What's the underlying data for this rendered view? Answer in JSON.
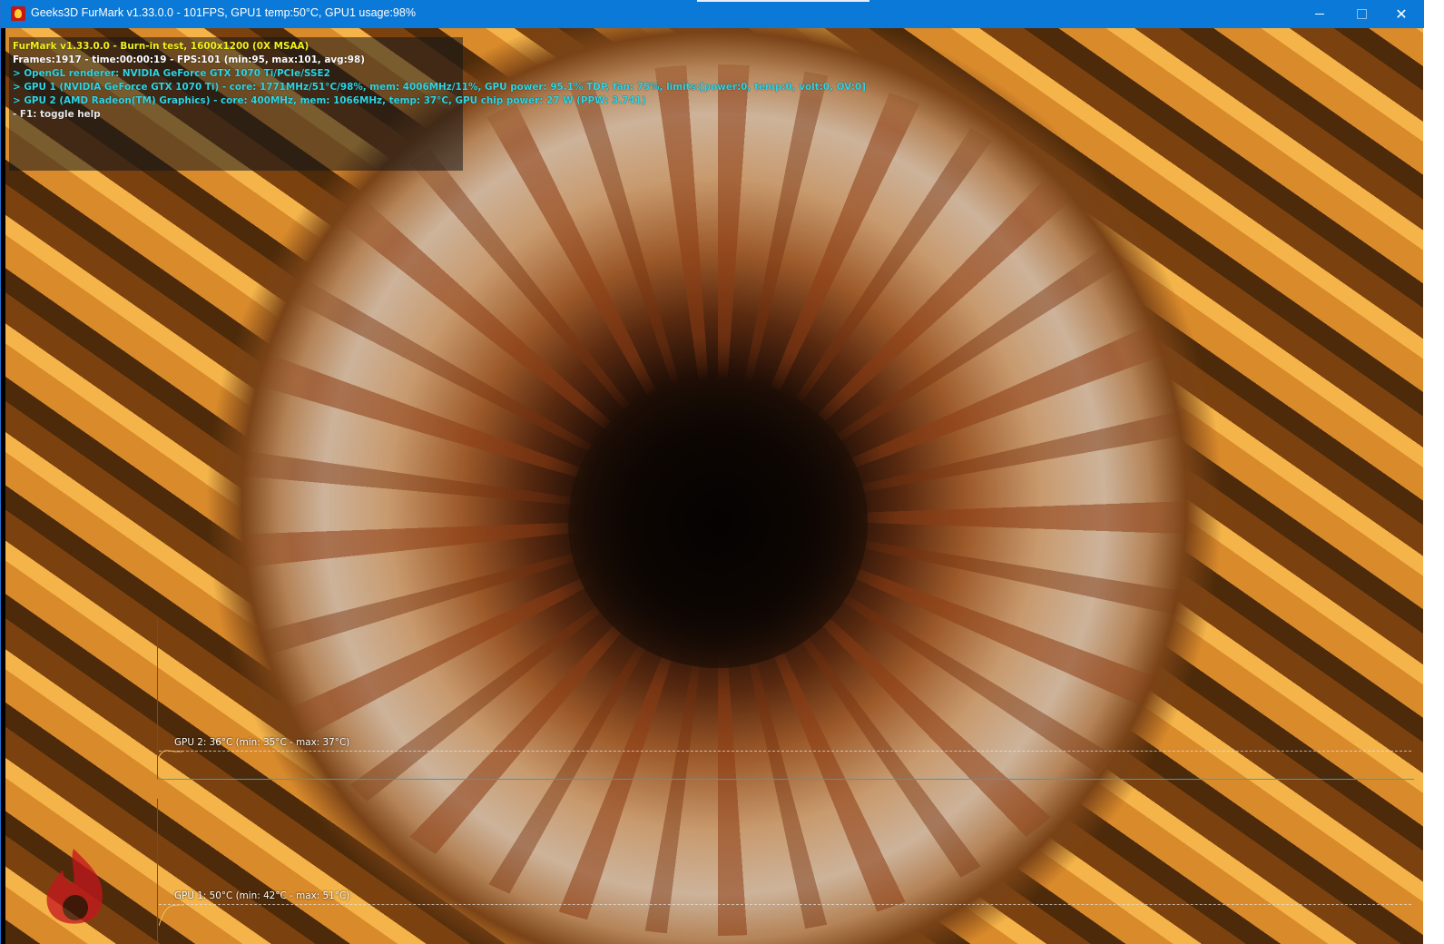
{
  "window": {
    "title": "Geeks3D FurMark v1.33.0.0 - 101FPS, GPU1 temp:50°C, GPU1 usage:98%",
    "controls": {
      "minimize": "minimize",
      "maximize": "maximize",
      "close": "✕"
    }
  },
  "hud": {
    "line1": "FurMark v1.33.0.0 - Burn-in test, 1600x1200 (0X MSAA)",
    "line2": "Frames:1917 - time:00:00:19 - FPS:101 (min:95, max:101, avg:98)",
    "line3": "> OpenGL renderer: NVIDIA GeForce GTX 1070 Ti/PCIe/SSE2",
    "line4": "> GPU 1 (NVIDIA GeForce GTX 1070 Ti) - core: 1771MHz/51°C/98%, mem: 4006MHz/11%, GPU power: 95.1% TDP, fan: 75%, limits:[power:0, temp:0, volt:0, OV:0]",
    "line5": "> GPU 2 (AMD Radeon(TM) Graphics) - core: 400MHz, mem: 1066MHz, temp: 37°C, GPU chip power: 27 W (PPW: 3.741)",
    "line6": "- F1: toggle help"
  },
  "graphs": {
    "gpu2_label": "GPU 2: 36°C (min: 35°C - max: 37°C)",
    "gpu1_label": "GPU 1: 50°C (min: 42°C - max: 51°C)"
  },
  "colors": {
    "titlebar": "#0b79d7",
    "hud_yellow": "#f3f31c",
    "hud_cyan": "#2fd6e6",
    "axis_red": "#e21a1a",
    "axis_blue": "#2aa3c8"
  },
  "icons": {
    "app": "furmark-app-icon",
    "logo": "furmark-flame-logo"
  }
}
